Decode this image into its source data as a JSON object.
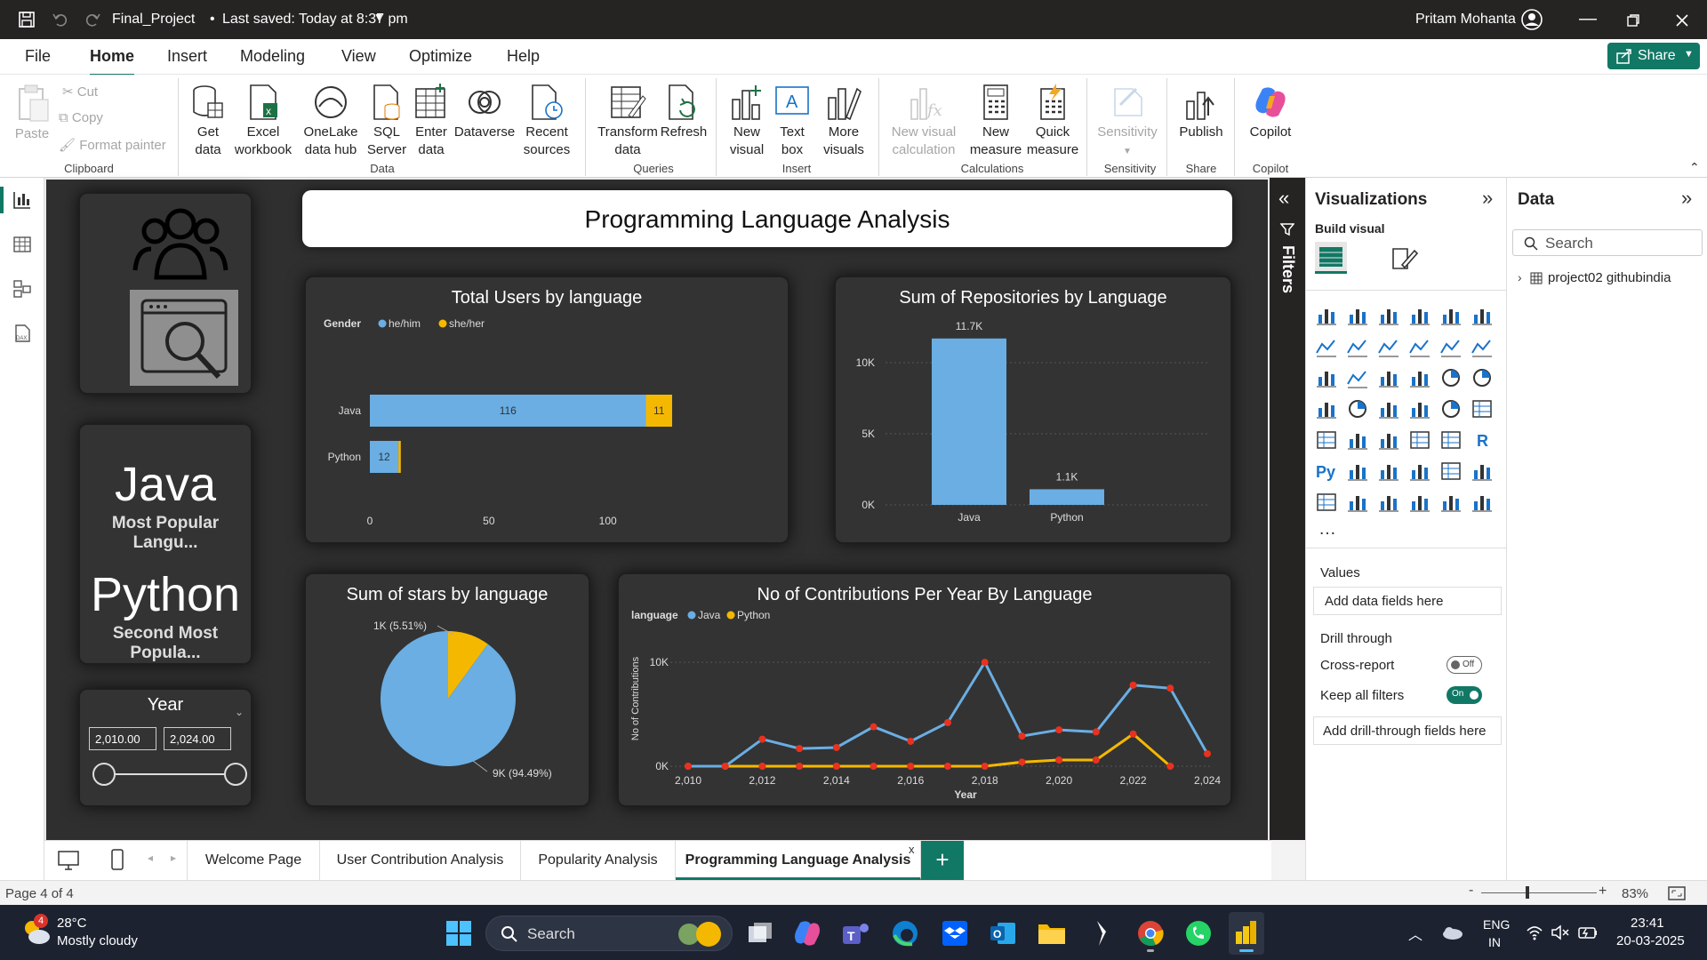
{
  "title_bar": {
    "file_name": "Final_Project",
    "saved_status": "Last saved: Today at 8:37 pm",
    "user_name": "Pritam Mohanta"
  },
  "menu": [
    "File",
    "Home",
    "Insert",
    "Modeling",
    "View",
    "Optimize",
    "Help"
  ],
  "share_label": "Share",
  "ribbon": {
    "clipboard": {
      "paste": "Paste",
      "cut": "Cut",
      "copy": "Copy",
      "format_painter": "Format painter",
      "group": "Clipboard"
    },
    "data": {
      "get_data": [
        "Get",
        "data"
      ],
      "excel": [
        "Excel",
        "workbook"
      ],
      "onelake": [
        "OneLake",
        "data hub"
      ],
      "sql": [
        "SQL",
        "Server"
      ],
      "enter": [
        "Enter",
        "data"
      ],
      "dataverse": "Dataverse",
      "recent": [
        "Recent",
        "sources"
      ],
      "group": "Data"
    },
    "queries": {
      "transform": [
        "Transform",
        "data"
      ],
      "refresh": "Refresh",
      "group": "Queries"
    },
    "insert": {
      "new_visual": [
        "New",
        "visual"
      ],
      "text_box": [
        "Text",
        "box"
      ],
      "more_visuals": [
        "More",
        "visuals"
      ],
      "group": "Insert"
    },
    "calculations": {
      "new_visual_calc": [
        "New visual",
        "calculation"
      ],
      "new_measure": [
        "New",
        "measure"
      ],
      "quick_measure": [
        "Quick",
        "measure"
      ],
      "group": "Calculations"
    },
    "sensitivity": {
      "label": "Sensitivity",
      "group": "Sensitivity"
    },
    "share": {
      "publish": "Publish",
      "group": "Share"
    },
    "copilot": {
      "label": "Copilot",
      "group": "Copilot"
    }
  },
  "report": {
    "title": "Programming Language Analysis",
    "card_java": {
      "value": "Java",
      "label": "Most Popular Langu..."
    },
    "card_python": {
      "value": "Python",
      "label": "Second Most Popula..."
    },
    "slicer": {
      "title": "Year",
      "from": "2,010.00",
      "to": "2,024.00"
    }
  },
  "chart_data": [
    {
      "type": "bar",
      "title": "Total Users by language",
      "legend_title": "Gender",
      "categories": [
        "Java",
        "Python"
      ],
      "series": [
        {
          "name": "he/him",
          "values": [
            116,
            12
          ],
          "color": "#6aaee3"
        },
        {
          "name": "she/her",
          "values": [
            11,
            1
          ],
          "color": "#f5b800"
        }
      ],
      "data_labels": {
        "java_he": "116",
        "java_she": "11",
        "python_he": "12"
      },
      "x_ticks": [
        "0",
        "50",
        "100"
      ],
      "xlim": [
        0,
        130
      ],
      "legend": "top-left"
    },
    {
      "type": "bar",
      "title": "Sum of Repositories by Language",
      "categories": [
        "Java",
        "Python"
      ],
      "values": [
        11700,
        1100
      ],
      "value_labels": [
        "11.7K",
        "1.1K"
      ],
      "y_ticks": [
        "0K",
        "5K",
        "10K"
      ],
      "ylim": [
        0,
        12500
      ],
      "color": "#6aaee3"
    },
    {
      "type": "pie",
      "title": "Sum of stars by language",
      "slices": [
        {
          "name": "Java",
          "value": 9000,
          "label": "9K (94.49%)",
          "color": "#6aaee3"
        },
        {
          "name": "Python",
          "value": 1000,
          "label": "1K (5.51%)",
          "color": "#f5b800"
        }
      ]
    },
    {
      "type": "line",
      "title": "No of Contributions Per Year By Language",
      "legend_title": "language",
      "xlabel": "Year",
      "ylabel": "No of Contributions",
      "x": [
        2010,
        2011,
        2012,
        2013,
        2014,
        2015,
        2016,
        2017,
        2018,
        2019,
        2020,
        2021,
        2022,
        2023,
        2024
      ],
      "x_ticks": [
        "2,010",
        "2,012",
        "2,014",
        "2,016",
        "2,018",
        "2,020",
        "2,022",
        "2,024"
      ],
      "y_ticks": [
        "0K",
        "10K"
      ],
      "ylim": [
        0,
        13000
      ],
      "series": [
        {
          "name": "Java",
          "values": [
            0,
            0,
            2600,
            1700,
            1800,
            3800,
            2400,
            4200,
            10000,
            2900,
            3500,
            3300,
            7800,
            7500,
            1200
          ],
          "color": "#6aaee3"
        },
        {
          "name": "Python",
          "values": [
            0,
            0,
            0,
            0,
            0,
            0,
            0,
            0,
            0,
            400,
            600,
            600,
            3100,
            0,
            null
          ],
          "color": "#f5b800"
        }
      ],
      "legend": "top-left"
    }
  ],
  "visualizations": {
    "header": "Visualizations",
    "build_visual": "Build visual",
    "values_label": "Values",
    "values_placeholder": "Add data fields here",
    "drill_through": "Drill through",
    "cross_report": "Cross-report",
    "cross_state": "Off",
    "keep_filters": "Keep all filters",
    "keep_state": "On",
    "drill_placeholder": "Add drill-through fields here"
  },
  "data_pane": {
    "header": "Data",
    "search_placeholder": "Search",
    "table": "project02 githubindia"
  },
  "filters_label": "Filters",
  "tabs": [
    "Welcome Page",
    "User Contribution Analysis",
    "Popularity Analysis",
    "Programming Language Analysis"
  ],
  "status": {
    "page": "Page 4 of 4",
    "zoom": "83%"
  },
  "taskbar": {
    "temp": "28°C",
    "weather": "Mostly cloudy",
    "badge": "4",
    "search": "Search",
    "lang1": "ENG",
    "lang2": "IN",
    "time": "23:41",
    "date": "20-03-2025"
  }
}
